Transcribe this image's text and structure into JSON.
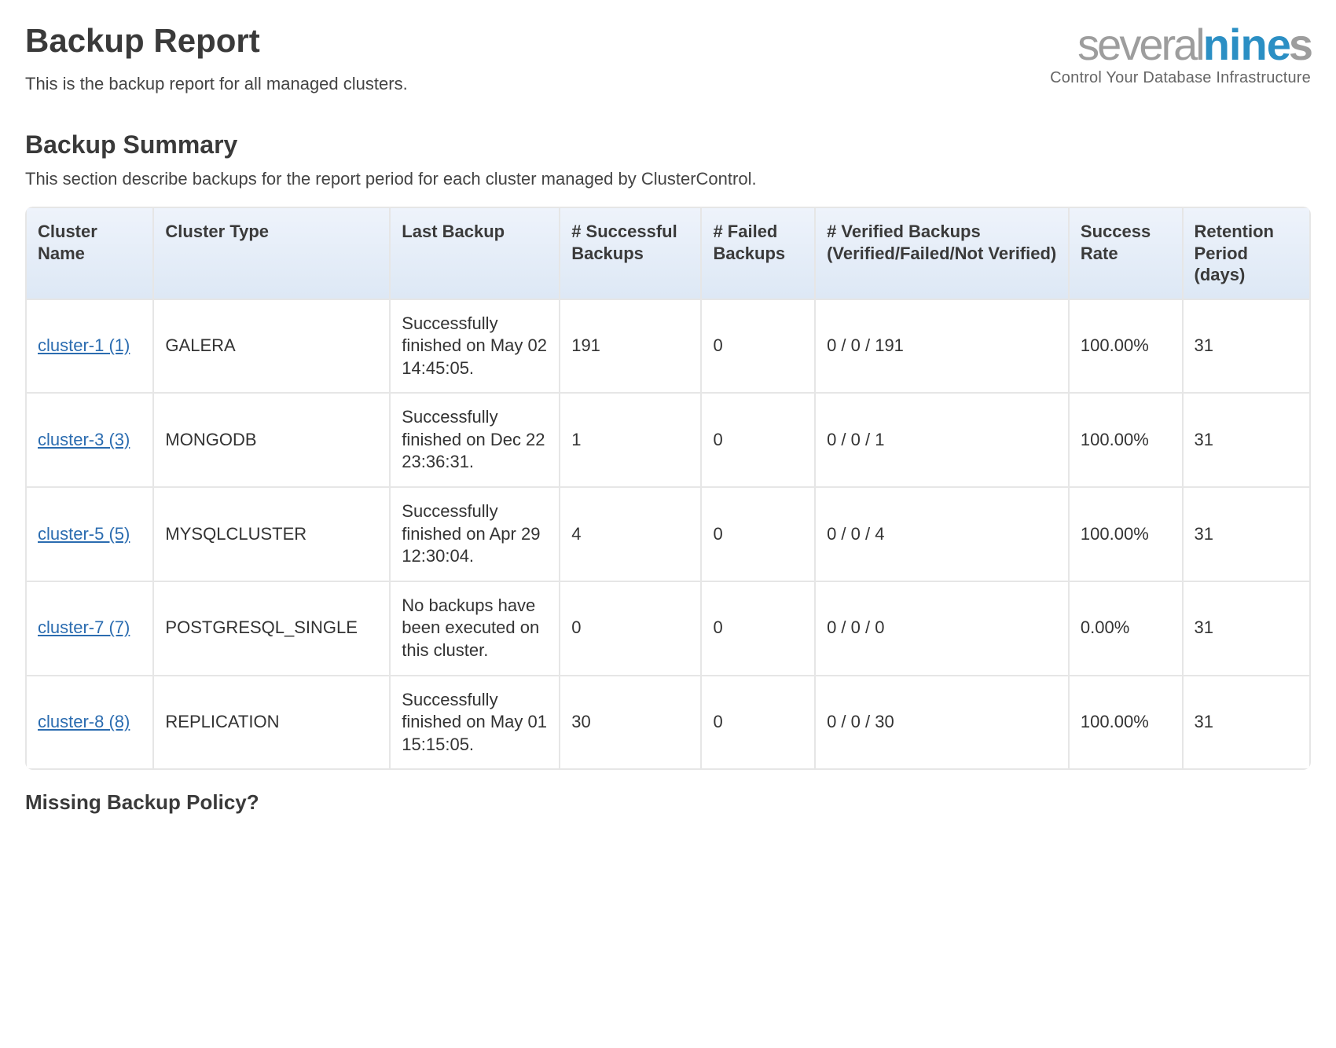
{
  "header": {
    "title": "Backup Report",
    "subtitle": "This is the backup report for all managed clusters."
  },
  "logo": {
    "word_left": "several",
    "word_nin": "nin",
    "word_e": "e",
    "word_s": "s",
    "tagline": "Control Your Database Infrastructure"
  },
  "summary": {
    "heading": "Backup Summary",
    "description": "This section describe backups for the report period for each cluster managed by ClusterControl."
  },
  "table": {
    "headers": {
      "cluster_name": "Cluster Name",
      "cluster_type": "Cluster Type",
      "last_backup": "Last Backup",
      "successful": "# Successful Backups",
      "failed": "# Failed Backups",
      "verified": "# Verified Backups (Verified/Failed/Not Verified)",
      "success_rate": "Success Rate",
      "retention": "Retention Period (days)"
    },
    "rows": [
      {
        "name": "cluster-1 (1)",
        "type": "GALERA",
        "last_backup": "Successfully finished on May 02 14:45:05.",
        "successful": "191",
        "failed": "0",
        "verified": "0 / 0 / 191",
        "success_rate": "100.00%",
        "retention": "31"
      },
      {
        "name": "cluster-3 (3)",
        "type": "MONGODB",
        "last_backup": "Successfully finished on Dec 22 23:36:31.",
        "successful": "1",
        "failed": "0",
        "verified": "0 / 0 / 1",
        "success_rate": "100.00%",
        "retention": "31"
      },
      {
        "name": "cluster-5 (5)",
        "type": "MYSQLCLUSTER",
        "last_backup": "Successfully finished on Apr 29 12:30:04.",
        "successful": "4",
        "failed": "0",
        "verified": "0 / 0 / 4",
        "success_rate": "100.00%",
        "retention": "31"
      },
      {
        "name": "cluster-7 (7)",
        "type": "POSTGRESQL_SINGLE",
        "last_backup": "No backups have been executed on this cluster.",
        "successful": "0",
        "failed": "0",
        "verified": "0 / 0 / 0",
        "success_rate": "0.00%",
        "retention": "31"
      },
      {
        "name": "cluster-8 (8)",
        "type": "REPLICATION",
        "last_backup": "Successfully finished on May 01 15:15:05.",
        "successful": "30",
        "failed": "0",
        "verified": "0 / 0 / 30",
        "success_rate": "100.00%",
        "retention": "31"
      }
    ]
  },
  "missing_policy": {
    "heading": "Missing Backup Policy?"
  }
}
